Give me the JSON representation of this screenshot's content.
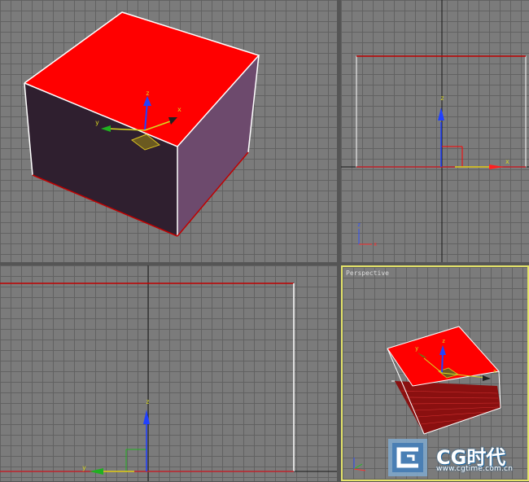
{
  "viewports": {
    "top_left": {
      "gizmo_x": "x",
      "gizmo_y": "y",
      "gizmo_z": "z"
    },
    "top_right": {
      "gizmo_x": "x",
      "gizmo_z": "z",
      "axis_x": "x",
      "axis_z": "z"
    },
    "bottom_left": {
      "gizmo_y": "y",
      "gizmo_z": "z"
    },
    "perspective": {
      "label": "Perspective",
      "gizmo_x": "x",
      "gizmo_y": "y",
      "gizmo_z": "z"
    }
  },
  "watermark": {
    "brand": "CG时代",
    "url": "www.cgtime.com.cn"
  },
  "colors": {
    "viewport_bg": "#7b7b7b",
    "selection_red": "#ff0000",
    "active_border": "#e4e36a",
    "axis_red": "#c0232a"
  }
}
